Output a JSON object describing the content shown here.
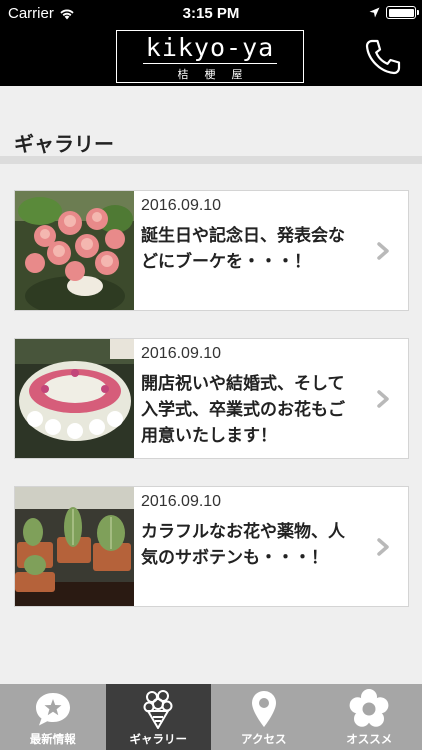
{
  "status_bar": {
    "carrier": "Carrier",
    "time": "3:15 PM"
  },
  "header": {
    "logo_latin": "kikyo-ya",
    "logo_kanji": "桔梗屋"
  },
  "section": {
    "title": "ギャラリー"
  },
  "gallery": [
    {
      "date": "2016.09.10",
      "text": "誕生日や記念日、発表会などにブーケを・・・！"
    },
    {
      "date": "2016.09.10",
      "text": "開店祝いや結婚式、そして入学式、卒業式のお花もご用意いたします！"
    },
    {
      "date": "2016.09.10",
      "text": "カラフルなお花や薬物、人気のサボテンも・・・！"
    }
  ],
  "tabs": [
    {
      "label": "最新情報",
      "icon": "speech-star-icon"
    },
    {
      "label": "ギャラリー",
      "icon": "bouquet-icon"
    },
    {
      "label": "アクセス",
      "icon": "map-pin-icon"
    },
    {
      "label": "オススメ",
      "icon": "flower-icon"
    }
  ],
  "colors": {
    "header_bg": "#000000",
    "page_bg": "#efefef",
    "tabbar_bg": "#a6a6a6",
    "tab_active_bg": "#3d3d3d"
  }
}
